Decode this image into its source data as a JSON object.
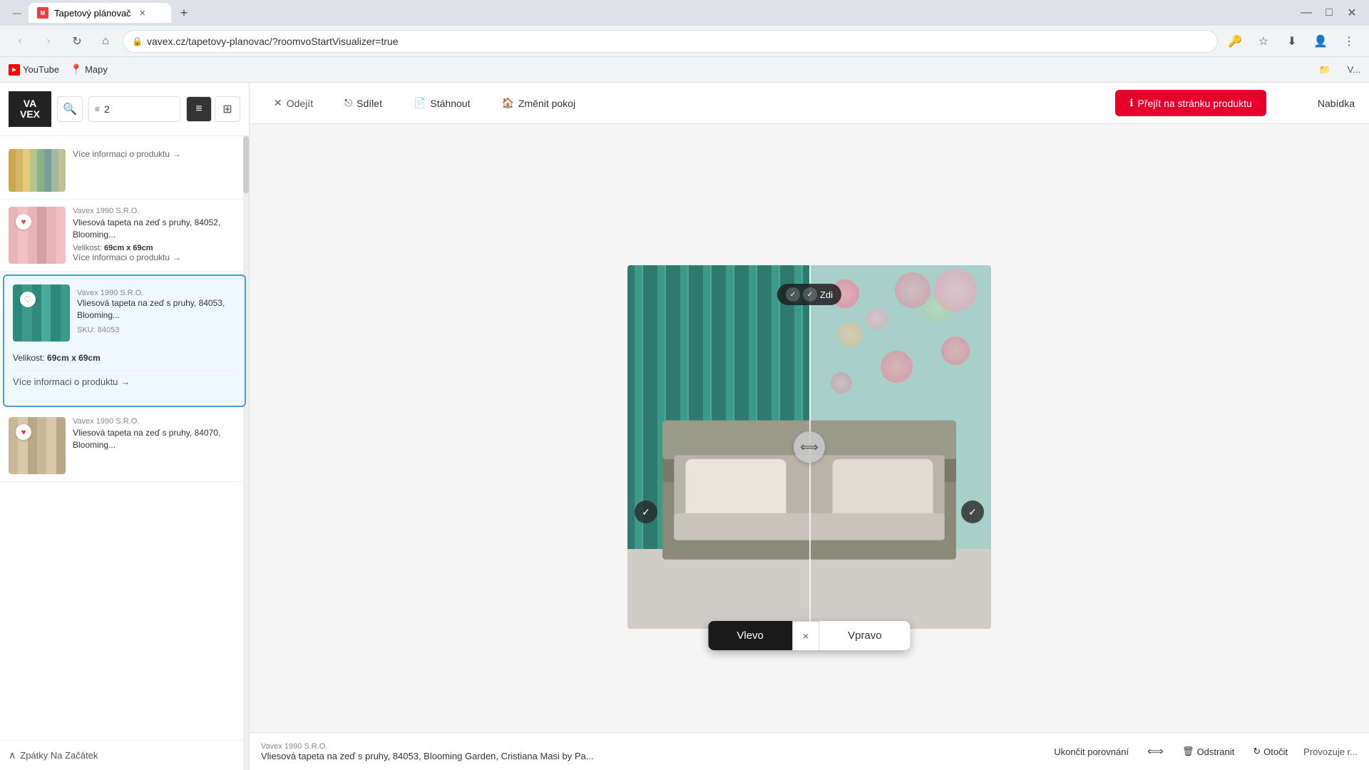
{
  "browser": {
    "tab_title": "Tapetový plánovač",
    "url": "vavex.cz/tapetovy-planovac/?roomvoStartVisualizer=true",
    "new_tab_tooltip": "New tab"
  },
  "bookmarks": [
    {
      "id": "youtube",
      "label": "YouTube",
      "type": "youtube"
    },
    {
      "id": "mapy",
      "label": "Mapy",
      "type": "maps"
    }
  ],
  "toolbar": {
    "exit_label": "Odejít",
    "share_label": "Sdílet",
    "download_label": "Stáhnout",
    "change_room_label": "Změnit pokoj",
    "go_to_product_label": "Přejít na stránku produktu",
    "nabidka_label": "Nabídka"
  },
  "sidebar": {
    "filter_value": "2",
    "filter_icon": "≡",
    "products": [
      {
        "id": "p1",
        "vendor": "",
        "name": "",
        "size": "",
        "more_info": "Více informaci o produktu",
        "has_heart": false,
        "is_top": true
      },
      {
        "id": "p2",
        "vendor": "Vavex 1990 S.R.O.",
        "name": "Vliesová tapeta na zeď s pruhy, 84052, Blooming...",
        "size": "69cm x 69cm",
        "more_info": "Více informaci o produktu",
        "has_heart": true,
        "sku": ""
      },
      {
        "id": "p3",
        "vendor": "Vavex 1990 S.R.O.",
        "name": "Vliesová tapeta na zeď s pruhy, 84053, Blooming...",
        "size": "69cm x 69cm",
        "sku": "84053",
        "sku_label": "SKU:",
        "more_info": "Více informaci o produktu",
        "has_heart": true,
        "selected": true
      },
      {
        "id": "p4",
        "vendor": "Vavex 1990 S.R.O.",
        "name": "Vliesová tapeta na zeď s pruhy, 84070, Blooming...",
        "more_info": "Více informaci o produktu",
        "has_heart": true
      }
    ],
    "back_to_top": "Zpátky Na Začátek",
    "velikost_label": "Velikost:"
  },
  "visualizer": {
    "wall_badge_left_check": "✓",
    "wall_badge_zdi": "Zdi",
    "corner_check": "✓",
    "comparison": {
      "vlevo_label": "Vlevo",
      "vpravo_label": "Vpravo",
      "close_icon": "×"
    }
  },
  "product_info_bar": {
    "vendor": "Vavex 1990 S.R.O.",
    "name": "Vliesová tapeta na zeď s pruhy, 84053, Blooming Garden, Cristiana Masi by Pa...",
    "end_compare_label": "Ukončit porovnání",
    "swap_label": "",
    "remove_label": "Odstranit",
    "rotate_label": "Otočit",
    "provozuje_label": "Provozuje r..."
  }
}
